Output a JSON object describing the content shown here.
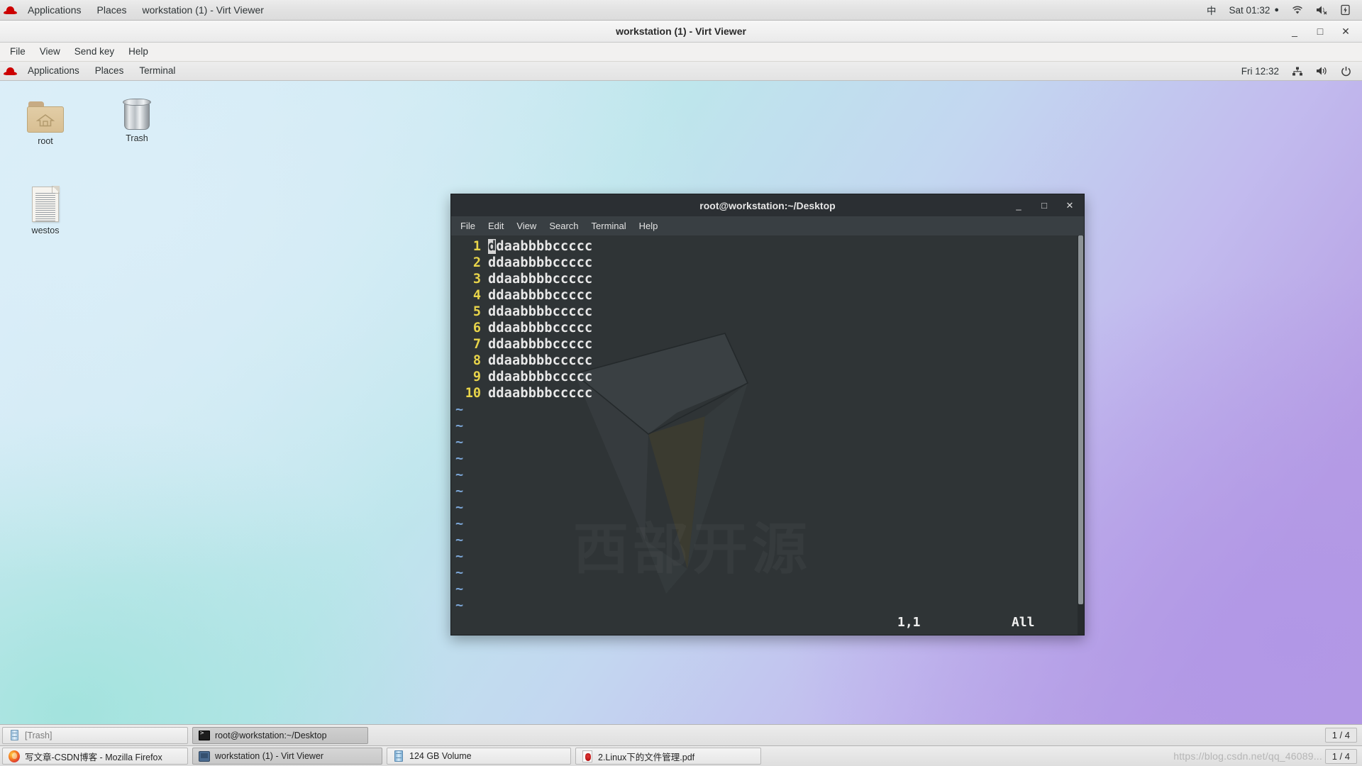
{
  "host": {
    "top_panel": {
      "logo_icon": "redhat-logo-icon",
      "menus": [
        "Applications",
        "Places"
      ],
      "window_title": "workstation (1) - Virt Viewer",
      "ime": "中",
      "clock": "Sat 01:32",
      "recording_dot": "●",
      "wifi_icon": "wifi-icon",
      "volume_icon": "volume-muted-icon",
      "battery_icon": "battery-charging-icon"
    },
    "taskbar": {
      "items": [
        {
          "label": "写文章-CSDN博客 - Mozilla Firefox",
          "icon": "firefox-icon"
        },
        {
          "label": "workstation (1) - Virt Viewer",
          "icon": "virt-viewer-icon"
        },
        {
          "label": "124 GB Volume",
          "icon": "volume-drive-icon"
        },
        {
          "label": "2.Linux下的文件管理.pdf",
          "icon": "pdf-icon"
        }
      ],
      "workspace": "1 / 4"
    },
    "watermark": "https://blog.csdn.net/qq_46089..."
  },
  "virt_viewer": {
    "title": "workstation (1) - Virt Viewer",
    "window_buttons": {
      "minimize": "_",
      "maximize": "□",
      "close": "✕"
    },
    "menus": [
      "File",
      "View",
      "Send key",
      "Help"
    ]
  },
  "guest": {
    "top_panel": {
      "logo_icon": "redhat-logo-icon",
      "menus": [
        "Applications",
        "Places",
        "Terminal"
      ],
      "clock": "Fri 12:32",
      "network_icon": "network-icon",
      "volume_icon": "volume-icon",
      "power_icon": "power-icon"
    },
    "desktop_icons": [
      {
        "label": "root",
        "icon": "home-folder-icon"
      },
      {
        "label": "Trash",
        "icon": "trash-icon"
      },
      {
        "label": "westos",
        "icon": "text-document-icon"
      }
    ],
    "taskbar": {
      "items": [
        {
          "label": "[Trash]",
          "icon": "trash-small-icon",
          "state": "minimized"
        },
        {
          "label": "root@workstation:~/Desktop",
          "icon": "terminal-icon",
          "state": "active"
        }
      ],
      "workspace": "1 / 4"
    }
  },
  "terminal": {
    "title": "root@workstation:~/Desktop",
    "window_buttons": {
      "minimize": "_",
      "maximize": "□",
      "close": "✕"
    },
    "menus": [
      "File",
      "Edit",
      "View",
      "Search",
      "Terminal",
      "Help"
    ],
    "watermark_text": "西部开源",
    "editor": {
      "lines": [
        {
          "number": "1",
          "text": "ddaabbbbccccc"
        },
        {
          "number": "2",
          "text": "ddaabbbbccccc"
        },
        {
          "number": "3",
          "text": "ddaabbbbccccc"
        },
        {
          "number": "4",
          "text": "ddaabbbbccccc"
        },
        {
          "number": "5",
          "text": "ddaabbbbccccc"
        },
        {
          "number": "6",
          "text": "ddaabbbbccccc"
        },
        {
          "number": "7",
          "text": "ddaabbbbccccc"
        },
        {
          "number": "8",
          "text": "ddaabbbbccccc"
        },
        {
          "number": "9",
          "text": "ddaabbbbccccc"
        },
        {
          "number": "10",
          "text": "ddaabbbbccccc"
        }
      ],
      "cursor_char": "d",
      "empty_marker": "~",
      "empty_line_count": 13,
      "status_position": "1,1",
      "status_scroll": "All"
    },
    "colors": {
      "background": "#2f3436",
      "line_number": "#e8d44a",
      "text": "#e8e8e8",
      "tilde": "#7ba5d6",
      "titlebar": "#2b2f33"
    }
  }
}
